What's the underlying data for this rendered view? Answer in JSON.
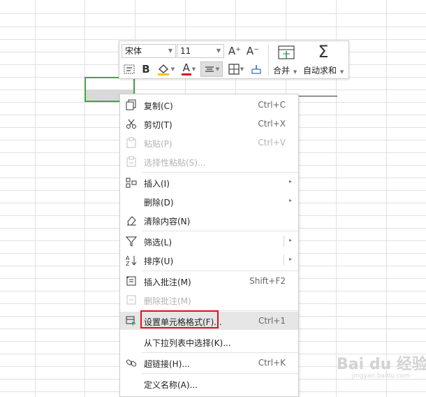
{
  "toolbar": {
    "font_name": "宋体",
    "font_size": "11",
    "increase_font_glyph": "A⁺",
    "decrease_font_glyph": "A⁻",
    "bold_glyph": "B",
    "font_color_glyph": "A",
    "merge_label": "合并",
    "autosum_label": "自动求和",
    "sigma_glyph": "Σ",
    "accent_red": "#e0101a"
  },
  "menu": {
    "items": [
      {
        "label": "复制(C)",
        "shortcut": "Ctrl+C",
        "icon": "copy-icon"
      },
      {
        "label": "剪切(T)",
        "shortcut": "Ctrl+X",
        "icon": "scissors-icon"
      },
      {
        "label": "粘贴(P)",
        "shortcut": "Ctrl+V",
        "icon": "paste-icon",
        "disabled": true
      },
      {
        "label": "选择性粘贴(S)...",
        "icon": "paste-special-icon",
        "disabled": true
      },
      {
        "label": "插入(I)",
        "icon": "insert-icon",
        "submenu": true
      },
      {
        "label": "删除(D)",
        "submenu": true
      },
      {
        "label": "清除内容(N)",
        "icon": "eraser-icon"
      },
      {
        "label": "筛选(L)",
        "icon": "filter-icon",
        "submenu": true
      },
      {
        "label": "排序(U)",
        "icon": "sort-icon",
        "submenu": true
      },
      {
        "label": "插入批注(M)",
        "shortcut": "Shift+F2",
        "icon": "comment-icon"
      },
      {
        "label": "删除批注(M)",
        "icon": "delete-comment-icon",
        "disabled": true
      },
      {
        "label": "设置单元格格式(F)...",
        "shortcut": "Ctrl+1",
        "icon": "format-cells-icon",
        "highlighted": true
      },
      {
        "label": "从下拉列表中选择(K)..."
      },
      {
        "label": "超链接(H)...",
        "shortcut": "Ctrl+K",
        "icon": "link-icon"
      },
      {
        "label": "定义名称(A)..."
      }
    ],
    "submenu_arrow": "▸"
  },
  "watermark": {
    "text": "Bai du 经验",
    "sub": "jingyan.baidu.com"
  }
}
